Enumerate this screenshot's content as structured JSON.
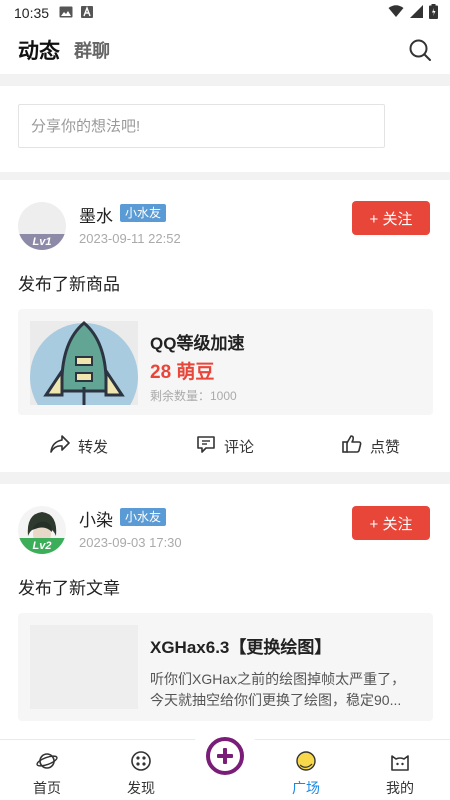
{
  "status_bar": {
    "time": "10:35"
  },
  "header": {
    "tab_active": "动态",
    "tab_other": "群聊"
  },
  "share": {
    "placeholder": "分享你的想法吧!"
  },
  "posts": [
    {
      "username": "墨水",
      "badge": "小水友",
      "level": "Lv1",
      "time": "2023-09-11 22:52",
      "follow_label": "+ 关注",
      "text": "发布了新商品",
      "item": {
        "title": "QQ等级加速",
        "price": "28 萌豆",
        "stock": "剩余数量：1000"
      },
      "actions": {
        "share": "转发",
        "comment": "评论",
        "like": "点赞"
      }
    },
    {
      "username": "小染",
      "badge": "小水友",
      "level": "Lv2",
      "time": "2023-09-03 17:30",
      "follow_label": "+ 关注",
      "text": "发布了新文章",
      "item": {
        "title": "XGHax6.3【更换绘图】",
        "desc_line1": "听你们XGHax之前的绘图掉帧太严重了，",
        "desc_line2": "今天就抽空给你们更换了绘图，稳定90..."
      }
    }
  ],
  "bottom_nav": {
    "items": [
      {
        "label": "首页"
      },
      {
        "label": "发现"
      },
      {
        "label": "广场"
      },
      {
        "label": "我的"
      }
    ],
    "active": "广场"
  },
  "colors": {
    "accent_red": "#e9463a",
    "badge_blue": "#5b9bd5",
    "nav_active": "#1e88e5",
    "plus_purple": "#7a1d78"
  }
}
